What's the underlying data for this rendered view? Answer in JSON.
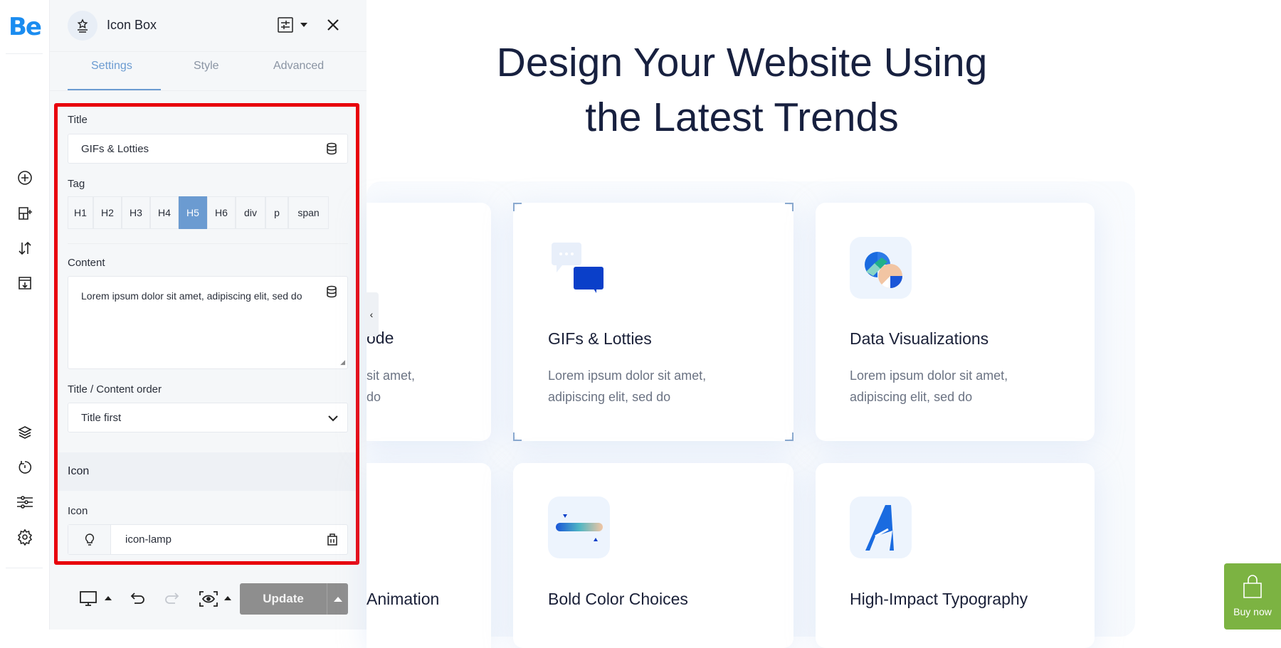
{
  "brand": {
    "logo": "Be",
    "color": "#1a8cf0"
  },
  "rail": {
    "icons": [
      "plus-circle-icon",
      "add-section-icon",
      "sort-icon",
      "export-icon",
      "layers-icon",
      "history-icon",
      "sliders-icon",
      "gear-icon"
    ]
  },
  "panel": {
    "title": "Icon Box",
    "tabs": [
      {
        "label": "Settings",
        "active": true
      },
      {
        "label": "Style"
      },
      {
        "label": "Advanced"
      }
    ],
    "title_label": "Title",
    "title_value": "GIFs & Lotties",
    "tag_label": "Tag",
    "tags": [
      "H1",
      "H2",
      "H3",
      "H4",
      "H5",
      "H6",
      "div",
      "p",
      "span"
    ],
    "tag_selected": "H5",
    "content_label": "Content",
    "content_value": "Lorem ipsum dolor sit amet, adipiscing elit, sed do",
    "order_label": "Title / Content order",
    "order_value": "Title first",
    "icon_section": "Icon",
    "icon_label": "Icon",
    "icon_value": "icon-lamp",
    "update_label": "Update"
  },
  "page": {
    "heading_line1": "Design Your Website Using",
    "heading_line2": "the Latest Trends",
    "cards": [
      {
        "title": "ode",
        "desc1": "sit amet,",
        "desc2": "do"
      },
      {
        "title": "GIFs & Lotties",
        "desc1": "Lorem ipsum dolor sit amet,",
        "desc2": "adipiscing elit, sed do"
      },
      {
        "title": "Data Visualizations",
        "desc1": "Lorem ipsum dolor sit amet,",
        "desc2": "adipiscing elit, sed do"
      },
      {
        "title": "Animation"
      },
      {
        "title": "Bold Color Choices"
      },
      {
        "title": "High-Impact Typography"
      }
    ],
    "buy_now": "Buy now",
    "buy_color": "#7cb342"
  }
}
